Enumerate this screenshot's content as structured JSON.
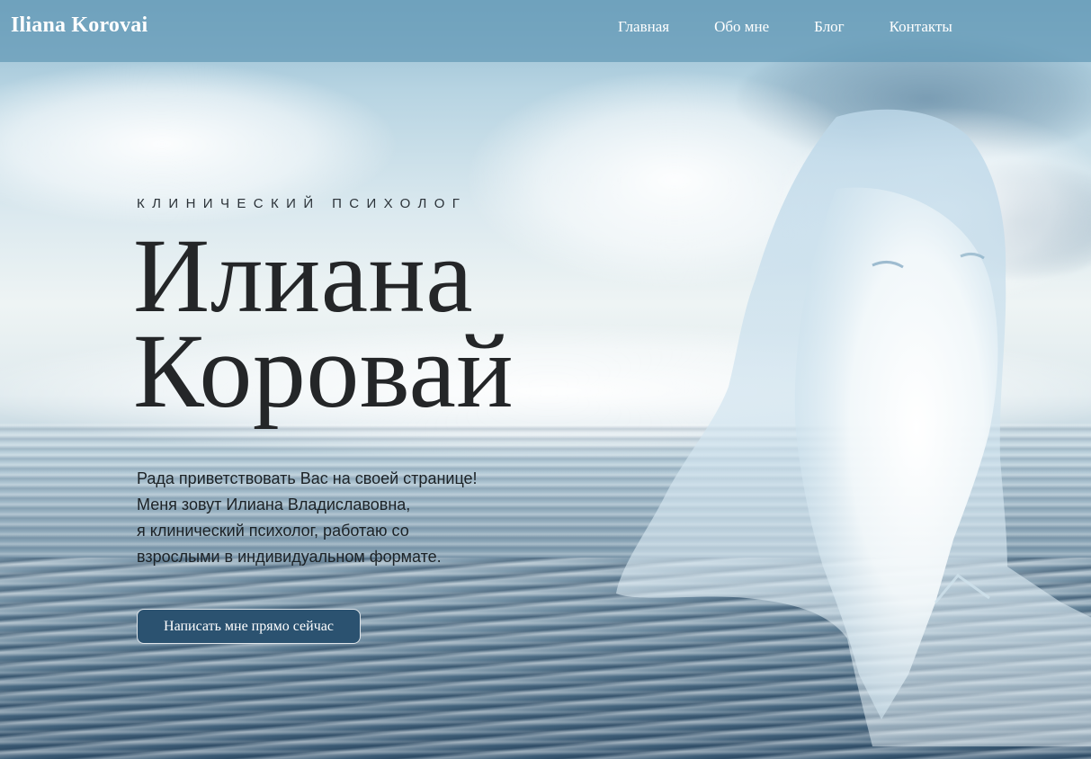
{
  "header": {
    "logo": "Iliana Korovai",
    "nav": [
      {
        "label": "Главная"
      },
      {
        "label": "Обо мне"
      },
      {
        "label": "Блог"
      },
      {
        "label": "Контакты"
      }
    ]
  },
  "hero": {
    "subtitle": "КЛИНИЧЕСКИЙ ПСИХОЛОГ",
    "name_line1": "Илиана",
    "name_line2": "Коровай",
    "intro": [
      "Рада приветствовать Вас на своей странице!",
      "Меня зовут Илиана Владиславовна,",
      "я клинический психолог, работаю со",
      "взрослыми в индивидуальном формате."
    ],
    "cta_label": "Написать мне прямо сейчас"
  },
  "colors": {
    "header_bg": "#6298b6",
    "cta_bg": "#2b5270",
    "title_text": "#242628",
    "sky_top": "#8fb9cf",
    "sea_dark": "#3e5e78"
  }
}
